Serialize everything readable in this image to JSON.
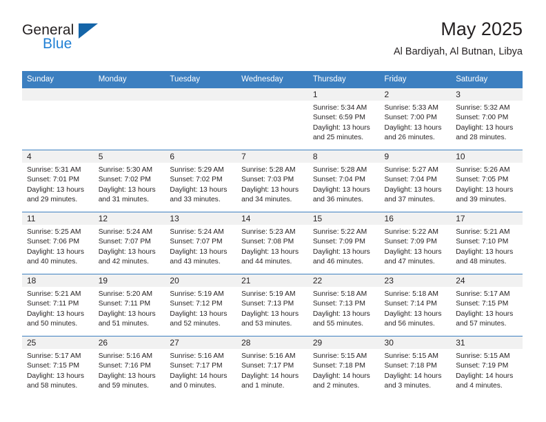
{
  "brand": {
    "name_top": "General",
    "name_bottom": "Blue",
    "triangle_color": "#1565a8",
    "blue_text_color": "#1f7fd4"
  },
  "header": {
    "month_title": "May 2025",
    "location": "Al Bardiyah, Al Butnan, Libya"
  },
  "theme": {
    "header_row_bg": "#3c7fc0",
    "header_row_text": "#ffffff",
    "daynum_band_bg": "#f1f1f1",
    "row_separator": "#3c7fc0",
    "body_text": "#231f20"
  },
  "calendar": {
    "weekday_headers": [
      "Sunday",
      "Monday",
      "Tuesday",
      "Wednesday",
      "Thursday",
      "Friday",
      "Saturday"
    ],
    "weeks": [
      [
        {
          "day": "",
          "empty": true
        },
        {
          "day": "",
          "empty": true
        },
        {
          "day": "",
          "empty": true
        },
        {
          "day": "",
          "empty": true
        },
        {
          "day": "1",
          "sunrise": "Sunrise: 5:34 AM",
          "sunset": "Sunset: 6:59 PM",
          "daylight_1": "Daylight: 13 hours",
          "daylight_2": "and 25 minutes."
        },
        {
          "day": "2",
          "sunrise": "Sunrise: 5:33 AM",
          "sunset": "Sunset: 7:00 PM",
          "daylight_1": "Daylight: 13 hours",
          "daylight_2": "and 26 minutes."
        },
        {
          "day": "3",
          "sunrise": "Sunrise: 5:32 AM",
          "sunset": "Sunset: 7:00 PM",
          "daylight_1": "Daylight: 13 hours",
          "daylight_2": "and 28 minutes."
        }
      ],
      [
        {
          "day": "4",
          "sunrise": "Sunrise: 5:31 AM",
          "sunset": "Sunset: 7:01 PM",
          "daylight_1": "Daylight: 13 hours",
          "daylight_2": "and 29 minutes."
        },
        {
          "day": "5",
          "sunrise": "Sunrise: 5:30 AM",
          "sunset": "Sunset: 7:02 PM",
          "daylight_1": "Daylight: 13 hours",
          "daylight_2": "and 31 minutes."
        },
        {
          "day": "6",
          "sunrise": "Sunrise: 5:29 AM",
          "sunset": "Sunset: 7:02 PM",
          "daylight_1": "Daylight: 13 hours",
          "daylight_2": "and 33 minutes."
        },
        {
          "day": "7",
          "sunrise": "Sunrise: 5:28 AM",
          "sunset": "Sunset: 7:03 PM",
          "daylight_1": "Daylight: 13 hours",
          "daylight_2": "and 34 minutes."
        },
        {
          "day": "8",
          "sunrise": "Sunrise: 5:28 AM",
          "sunset": "Sunset: 7:04 PM",
          "daylight_1": "Daylight: 13 hours",
          "daylight_2": "and 36 minutes."
        },
        {
          "day": "9",
          "sunrise": "Sunrise: 5:27 AM",
          "sunset": "Sunset: 7:04 PM",
          "daylight_1": "Daylight: 13 hours",
          "daylight_2": "and 37 minutes."
        },
        {
          "day": "10",
          "sunrise": "Sunrise: 5:26 AM",
          "sunset": "Sunset: 7:05 PM",
          "daylight_1": "Daylight: 13 hours",
          "daylight_2": "and 39 minutes."
        }
      ],
      [
        {
          "day": "11",
          "sunrise": "Sunrise: 5:25 AM",
          "sunset": "Sunset: 7:06 PM",
          "daylight_1": "Daylight: 13 hours",
          "daylight_2": "and 40 minutes."
        },
        {
          "day": "12",
          "sunrise": "Sunrise: 5:24 AM",
          "sunset": "Sunset: 7:07 PM",
          "daylight_1": "Daylight: 13 hours",
          "daylight_2": "and 42 minutes."
        },
        {
          "day": "13",
          "sunrise": "Sunrise: 5:24 AM",
          "sunset": "Sunset: 7:07 PM",
          "daylight_1": "Daylight: 13 hours",
          "daylight_2": "and 43 minutes."
        },
        {
          "day": "14",
          "sunrise": "Sunrise: 5:23 AM",
          "sunset": "Sunset: 7:08 PM",
          "daylight_1": "Daylight: 13 hours",
          "daylight_2": "and 44 minutes."
        },
        {
          "day": "15",
          "sunrise": "Sunrise: 5:22 AM",
          "sunset": "Sunset: 7:09 PM",
          "daylight_1": "Daylight: 13 hours",
          "daylight_2": "and 46 minutes."
        },
        {
          "day": "16",
          "sunrise": "Sunrise: 5:22 AM",
          "sunset": "Sunset: 7:09 PM",
          "daylight_1": "Daylight: 13 hours",
          "daylight_2": "and 47 minutes."
        },
        {
          "day": "17",
          "sunrise": "Sunrise: 5:21 AM",
          "sunset": "Sunset: 7:10 PM",
          "daylight_1": "Daylight: 13 hours",
          "daylight_2": "and 48 minutes."
        }
      ],
      [
        {
          "day": "18",
          "sunrise": "Sunrise: 5:21 AM",
          "sunset": "Sunset: 7:11 PM",
          "daylight_1": "Daylight: 13 hours",
          "daylight_2": "and 50 minutes."
        },
        {
          "day": "19",
          "sunrise": "Sunrise: 5:20 AM",
          "sunset": "Sunset: 7:11 PM",
          "daylight_1": "Daylight: 13 hours",
          "daylight_2": "and 51 minutes."
        },
        {
          "day": "20",
          "sunrise": "Sunrise: 5:19 AM",
          "sunset": "Sunset: 7:12 PM",
          "daylight_1": "Daylight: 13 hours",
          "daylight_2": "and 52 minutes."
        },
        {
          "day": "21",
          "sunrise": "Sunrise: 5:19 AM",
          "sunset": "Sunset: 7:13 PM",
          "daylight_1": "Daylight: 13 hours",
          "daylight_2": "and 53 minutes."
        },
        {
          "day": "22",
          "sunrise": "Sunrise: 5:18 AM",
          "sunset": "Sunset: 7:13 PM",
          "daylight_1": "Daylight: 13 hours",
          "daylight_2": "and 55 minutes."
        },
        {
          "day": "23",
          "sunrise": "Sunrise: 5:18 AM",
          "sunset": "Sunset: 7:14 PM",
          "daylight_1": "Daylight: 13 hours",
          "daylight_2": "and 56 minutes."
        },
        {
          "day": "24",
          "sunrise": "Sunrise: 5:17 AM",
          "sunset": "Sunset: 7:15 PM",
          "daylight_1": "Daylight: 13 hours",
          "daylight_2": "and 57 minutes."
        }
      ],
      [
        {
          "day": "25",
          "sunrise": "Sunrise: 5:17 AM",
          "sunset": "Sunset: 7:15 PM",
          "daylight_1": "Daylight: 13 hours",
          "daylight_2": "and 58 minutes."
        },
        {
          "day": "26",
          "sunrise": "Sunrise: 5:16 AM",
          "sunset": "Sunset: 7:16 PM",
          "daylight_1": "Daylight: 13 hours",
          "daylight_2": "and 59 minutes."
        },
        {
          "day": "27",
          "sunrise": "Sunrise: 5:16 AM",
          "sunset": "Sunset: 7:17 PM",
          "daylight_1": "Daylight: 14 hours",
          "daylight_2": "and 0 minutes."
        },
        {
          "day": "28",
          "sunrise": "Sunrise: 5:16 AM",
          "sunset": "Sunset: 7:17 PM",
          "daylight_1": "Daylight: 14 hours",
          "daylight_2": "and 1 minute."
        },
        {
          "day": "29",
          "sunrise": "Sunrise: 5:15 AM",
          "sunset": "Sunset: 7:18 PM",
          "daylight_1": "Daylight: 14 hours",
          "daylight_2": "and 2 minutes."
        },
        {
          "day": "30",
          "sunrise": "Sunrise: 5:15 AM",
          "sunset": "Sunset: 7:18 PM",
          "daylight_1": "Daylight: 14 hours",
          "daylight_2": "and 3 minutes."
        },
        {
          "day": "31",
          "sunrise": "Sunrise: 5:15 AM",
          "sunset": "Sunset: 7:19 PM",
          "daylight_1": "Daylight: 14 hours",
          "daylight_2": "and 4 minutes."
        }
      ]
    ]
  }
}
